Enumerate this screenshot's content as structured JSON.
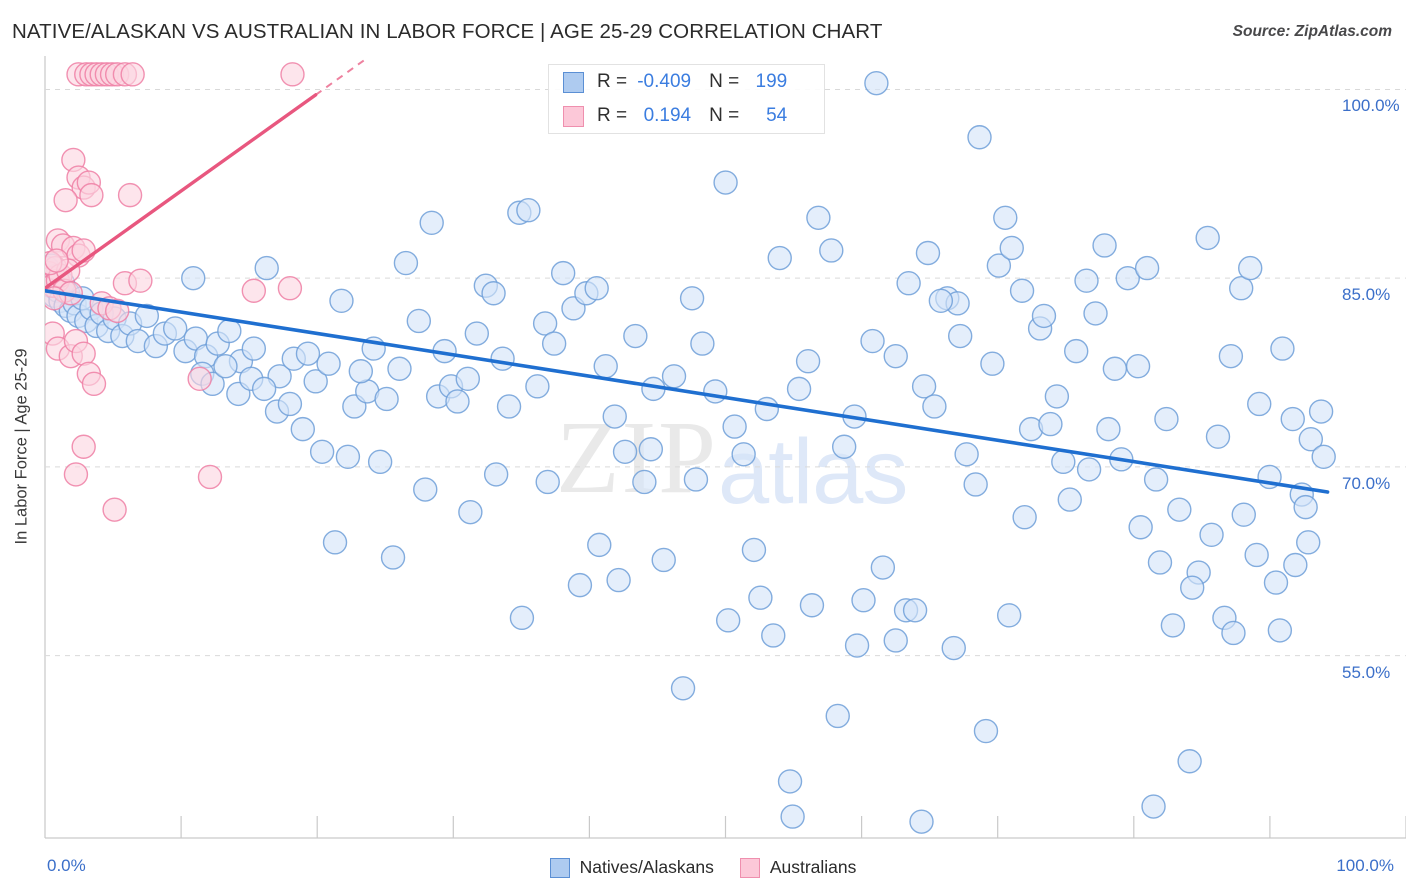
{
  "header": {
    "title": "NATIVE/ALASKAN VS AUSTRALIAN IN LABOR FORCE | AGE 25-29 CORRELATION CHART",
    "source": "Source: ZipAtlas.com"
  },
  "stats": {
    "rows": [
      {
        "series": "Natives/Alaskans",
        "color": "#aecbf0",
        "r_label": "R =",
        "r_value": "-0.409",
        "n_label": "N =",
        "n_value": "199"
      },
      {
        "series": "Australians",
        "color": "#fcc8d8",
        "r_label": "R =",
        "r_value": "0.194",
        "n_label": "N =",
        "n_value": "54"
      }
    ]
  },
  "legend": {
    "items": [
      {
        "label": "Natives/Alaskans",
        "color": "#aecbf0"
      },
      {
        "label": "Australians",
        "color": "#fcc8d8"
      }
    ]
  },
  "watermark": {
    "part1": "ZIP",
    "part2": "atlas"
  },
  "axes": {
    "y_title": "In Labor Force | Age 25-29",
    "y_ticks": [
      "100.0%",
      "85.0%",
      "70.0%",
      "55.0%"
    ],
    "x_min_label": "0.0%",
    "x_max_label": "100.0%"
  },
  "chart_data": {
    "type": "scatter",
    "title": "NATIVE/ALASKAN VS AUSTRALIAN IN LABOR FORCE | AGE 25-29 CORRELATION CHART",
    "xlabel": "",
    "ylabel": "In Labor Force | Age 25-29",
    "xlim": [
      0,
      100
    ],
    "ylim": [
      40.5,
      102.5
    ],
    "x_tick_values": [
      0,
      100
    ],
    "y_tick_values": [
      100.0,
      85.0,
      70.0,
      55.0
    ],
    "grid": "horizontal-dashed",
    "legend_position": "bottom-center",
    "series": [
      {
        "name": "Natives/Alaskans",
        "color": "#d4e4f8",
        "edge_color": "#6f9fd8",
        "r": -0.409,
        "n": 199,
        "trendline": {
          "x0": 0.0,
          "y0": 84.0,
          "x1": 99.5,
          "y1": 68.0,
          "color": "#1f6fd0",
          "style": "solid"
        },
        "points": [
          [
            0.2,
            85.8
          ],
          [
            0.3,
            85.0
          ],
          [
            0.4,
            84.4
          ],
          [
            0.5,
            86.0
          ],
          [
            0.6,
            84.8
          ],
          [
            0.7,
            83.6
          ],
          [
            0.9,
            85.2
          ],
          [
            1.0,
            84.0
          ],
          [
            1.2,
            83.2
          ],
          [
            1.4,
            84.6
          ],
          [
            1.6,
            82.8
          ],
          [
            1.8,
            83.8
          ],
          [
            2.0,
            82.4
          ],
          [
            2.3,
            83.0
          ],
          [
            2.6,
            82.0
          ],
          [
            2.9,
            83.4
          ],
          [
            3.2,
            81.6
          ],
          [
            3.6,
            82.6
          ],
          [
            4.0,
            81.2
          ],
          [
            4.4,
            82.2
          ],
          [
            4.9,
            80.8
          ],
          [
            5.4,
            81.8
          ],
          [
            6.0,
            80.4
          ],
          [
            6.6,
            81.4
          ],
          [
            7.2,
            80.0
          ],
          [
            7.9,
            82.0
          ],
          [
            8.6,
            79.6
          ],
          [
            9.3,
            80.6
          ],
          [
            10.1,
            81.0
          ],
          [
            10.9,
            79.2
          ],
          [
            11.7,
            80.2
          ],
          [
            12.5,
            78.8
          ],
          [
            13.4,
            79.8
          ],
          [
            14.3,
            80.8
          ],
          [
            15.2,
            78.4
          ],
          [
            16.2,
            79.4
          ],
          [
            17.2,
            85.8
          ],
          [
            18.2,
            77.2
          ],
          [
            19.3,
            78.6
          ],
          [
            20.4,
            79.0
          ],
          [
            11.5,
            85.0
          ],
          [
            12.2,
            77.4
          ],
          [
            13.0,
            76.6
          ],
          [
            14.0,
            78.0
          ],
          [
            15.0,
            75.8
          ],
          [
            16.0,
            77.0
          ],
          [
            17.0,
            76.2
          ],
          [
            18.0,
            74.4
          ],
          [
            19.0,
            75.0
          ],
          [
            20.0,
            73.0
          ],
          [
            21.0,
            76.8
          ],
          [
            22.0,
            78.2
          ],
          [
            23.0,
            83.2
          ],
          [
            24.0,
            74.8
          ],
          [
            25.0,
            76.0
          ],
          [
            26.0,
            70.4
          ],
          [
            21.5,
            71.2
          ],
          [
            22.5,
            64.0
          ],
          [
            24.5,
            77.6
          ],
          [
            25.5,
            79.4
          ],
          [
            26.5,
            75.4
          ],
          [
            27.5,
            77.8
          ],
          [
            28.0,
            86.2
          ],
          [
            29.0,
            81.6
          ],
          [
            30.0,
            89.4
          ],
          [
            30.5,
            75.6
          ],
          [
            31.0,
            79.2
          ],
          [
            31.5,
            76.4
          ],
          [
            32.0,
            75.2
          ],
          [
            32.8,
            77.0
          ],
          [
            33.5,
            80.6
          ],
          [
            34.2,
            84.4
          ],
          [
            34.8,
            83.8
          ],
          [
            35.5,
            78.6
          ],
          [
            36.0,
            74.8
          ],
          [
            36.8,
            90.2
          ],
          [
            37.5,
            90.4
          ],
          [
            38.2,
            76.4
          ],
          [
            38.8,
            81.4
          ],
          [
            39.5,
            79.8
          ],
          [
            40.2,
            85.4
          ],
          [
            41.0,
            82.6
          ],
          [
            42.0,
            83.8
          ],
          [
            42.8,
            84.2
          ],
          [
            43.5,
            78.0
          ],
          [
            44.2,
            74.0
          ],
          [
            45.0,
            71.2
          ],
          [
            45.8,
            80.4
          ],
          [
            46.5,
            68.8
          ],
          [
            47.2,
            76.2
          ],
          [
            48.0,
            62.6
          ],
          [
            48.8,
            77.2
          ],
          [
            49.5,
            52.4
          ],
          [
            50.2,
            83.4
          ],
          [
            51.0,
            79.8
          ],
          [
            52.0,
            76.0
          ],
          [
            52.8,
            92.6
          ],
          [
            53.5,
            73.2
          ],
          [
            54.2,
            71.0
          ],
          [
            55.0,
            63.4
          ],
          [
            56.0,
            74.6
          ],
          [
            57.0,
            86.6
          ],
          [
            57.8,
            45.0
          ],
          [
            58.5,
            76.2
          ],
          [
            59.2,
            78.4
          ],
          [
            60.0,
            89.8
          ],
          [
            61.0,
            87.2
          ],
          [
            62.0,
            71.6
          ],
          [
            62.8,
            74.0
          ],
          [
            63.5,
            59.4
          ],
          [
            64.2,
            80.0
          ],
          [
            65.0,
            62.0
          ],
          [
            66.0,
            78.8
          ],
          [
            66.8,
            58.6
          ],
          [
            67.5,
            58.6
          ],
          [
            68.2,
            76.4
          ],
          [
            69.0,
            74.8
          ],
          [
            70.0,
            83.4
          ],
          [
            70.8,
            83.0
          ],
          [
            71.5,
            71.0
          ],
          [
            72.2,
            68.6
          ],
          [
            73.0,
            49.0
          ],
          [
            74.0,
            86.0
          ],
          [
            75.0,
            87.4
          ],
          [
            75.8,
            84.0
          ],
          [
            76.5,
            73.0
          ],
          [
            77.2,
            81.0
          ],
          [
            78.0,
            73.4
          ],
          [
            79.0,
            70.4
          ],
          [
            80.0,
            79.2
          ],
          [
            80.8,
            84.8
          ],
          [
            81.5,
            82.2
          ],
          [
            82.2,
            87.6
          ],
          [
            83.0,
            77.8
          ],
          [
            84.0,
            85.0
          ],
          [
            84.8,
            78.0
          ],
          [
            85.5,
            85.8
          ],
          [
            86.2,
            69.0
          ],
          [
            87.0,
            73.8
          ],
          [
            88.0,
            66.6
          ],
          [
            88.8,
            46.6
          ],
          [
            89.5,
            61.6
          ],
          [
            90.2,
            88.2
          ],
          [
            91.0,
            72.4
          ],
          [
            92.0,
            78.8
          ],
          [
            92.8,
            84.2
          ],
          [
            93.5,
            85.8
          ],
          [
            94.2,
            75.0
          ],
          [
            95.0,
            69.2
          ],
          [
            96.0,
            79.4
          ],
          [
            96.8,
            73.8
          ],
          [
            97.5,
            67.8
          ],
          [
            98.2,
            72.2
          ],
          [
            99.0,
            74.4
          ],
          [
            64.5,
            100.5
          ],
          [
            72.5,
            96.2
          ],
          [
            74.5,
            89.8
          ],
          [
            67.0,
            84.6
          ],
          [
            68.5,
            87.0
          ],
          [
            69.5,
            83.2
          ],
          [
            71.0,
            80.4
          ],
          [
            73.5,
            78.2
          ],
          [
            77.5,
            82.0
          ],
          [
            78.5,
            75.6
          ],
          [
            82.5,
            73.0
          ],
          [
            83.5,
            70.6
          ],
          [
            85.0,
            65.2
          ],
          [
            86.5,
            62.4
          ],
          [
            87.5,
            57.4
          ],
          [
            89.0,
            60.4
          ],
          [
            90.5,
            64.6
          ],
          [
            91.5,
            58.0
          ],
          [
            93.0,
            66.2
          ],
          [
            94.0,
            63.0
          ],
          [
            95.5,
            60.8
          ],
          [
            97.0,
            62.2
          ],
          [
            98.0,
            64.0
          ],
          [
            99.2,
            70.8
          ],
          [
            79.5,
            67.4
          ],
          [
            81.0,
            69.8
          ],
          [
            76.0,
            66.0
          ],
          [
            74.8,
            58.2
          ],
          [
            70.5,
            55.6
          ],
          [
            66.0,
            56.2
          ],
          [
            63.0,
            55.8
          ],
          [
            59.5,
            59.0
          ],
          [
            55.5,
            59.6
          ],
          [
            50.5,
            69.0
          ],
          [
            47.0,
            71.4
          ],
          [
            43.0,
            63.8
          ],
          [
            39.0,
            68.8
          ],
          [
            35.0,
            69.4
          ],
          [
            33.0,
            66.4
          ],
          [
            29.5,
            68.2
          ],
          [
            27.0,
            62.8
          ],
          [
            23.5,
            70.8
          ],
          [
            37.0,
            58.0
          ],
          [
            41.5,
            60.6
          ],
          [
            44.5,
            61.0
          ],
          [
            53.0,
            57.8
          ],
          [
            56.5,
            56.6
          ],
          [
            61.5,
            50.2
          ],
          [
            86.0,
            43.0
          ],
          [
            58.0,
            42.2
          ],
          [
            68.0,
            41.8
          ],
          [
            95.8,
            57.0
          ],
          [
            92.2,
            56.8
          ],
          [
            97.8,
            66.8
          ]
        ]
      },
      {
        "name": "Australians",
        "color": "#fcd5e0",
        "edge_color": "#ef7fa4",
        "r": 0.194,
        "n": 54,
        "trendline": {
          "x0": 0.0,
          "y0": 84.2,
          "x1": 25.0,
          "y1": 102.5,
          "color": "#e8577f",
          "style": "solid-then-dashed",
          "dash_from_x": 21.0
        },
        "points": [
          [
            2.6,
            101.2
          ],
          [
            3.2,
            101.2
          ],
          [
            3.6,
            101.2
          ],
          [
            4.0,
            101.2
          ],
          [
            4.4,
            101.2
          ],
          [
            4.8,
            101.2
          ],
          [
            5.2,
            101.2
          ],
          [
            5.6,
            101.2
          ],
          [
            6.2,
            101.2
          ],
          [
            6.8,
            101.2
          ],
          [
            19.2,
            101.2
          ],
          [
            2.2,
            94.4
          ],
          [
            2.6,
            93.0
          ],
          [
            3.0,
            92.2
          ],
          [
            3.4,
            92.6
          ],
          [
            1.6,
            91.2
          ],
          [
            3.6,
            91.6
          ],
          [
            6.6,
            91.6
          ],
          [
            1.0,
            88.0
          ],
          [
            1.4,
            87.6
          ],
          [
            2.2,
            87.4
          ],
          [
            2.6,
            86.8
          ],
          [
            3.0,
            87.2
          ],
          [
            0.3,
            85.4
          ],
          [
            0.5,
            85.0
          ],
          [
            0.6,
            84.4
          ],
          [
            0.8,
            85.8
          ],
          [
            1.0,
            84.8
          ],
          [
            1.2,
            85.2
          ],
          [
            1.5,
            84.0
          ],
          [
            1.8,
            85.6
          ],
          [
            2.0,
            83.8
          ],
          [
            0.4,
            86.2
          ],
          [
            0.7,
            83.4
          ],
          [
            0.9,
            86.4
          ],
          [
            6.2,
            84.6
          ],
          [
            7.4,
            84.8
          ],
          [
            16.2,
            84.0
          ],
          [
            19.0,
            84.2
          ],
          [
            4.4,
            83.0
          ],
          [
            5.0,
            82.6
          ],
          [
            5.6,
            82.4
          ],
          [
            0.6,
            80.6
          ],
          [
            1.0,
            79.4
          ],
          [
            2.0,
            78.8
          ],
          [
            2.4,
            80.0
          ],
          [
            3.0,
            79.0
          ],
          [
            3.4,
            77.4
          ],
          [
            3.8,
            76.6
          ],
          [
            12.0,
            77.0
          ],
          [
            3.0,
            71.6
          ],
          [
            2.4,
            69.4
          ],
          [
            12.8,
            69.2
          ],
          [
            5.4,
            66.6
          ]
        ]
      }
    ]
  }
}
